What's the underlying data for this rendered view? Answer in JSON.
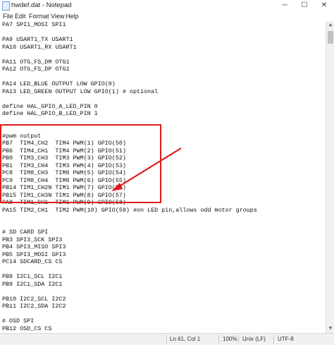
{
  "window": {
    "title": "hwdef.dat - Notepad",
    "minimize_icon": "─",
    "maximize_icon": "☐",
    "close_icon": "✕"
  },
  "menu": {
    "items": [
      "File",
      "Edit",
      "Format",
      "View",
      "Help"
    ]
  },
  "editor": {
    "lines": [
      "PA7 SPI1_MOSI SPI1",
      "",
      "PA9 USART1_TX USART1",
      "PA10 USART1_RX USART1",
      "",
      "PA11 OTG_FS_DM OTG1",
      "PA12 OTG_FS_DP OTG1",
      "",
      "PA14 LED_BLUE OUTPUT LOW GPIO(0)",
      "PA13 LED_GREEN OUTPUT LOW GPIO(1) # optional",
      "",
      "define HAL_GPIO_A_LED_PIN 0",
      "define HAL_GPIO_B_LED_PIN 1",
      "",
      "",
      "#pwm output",
      "PB7  TIM4_CH2  TIM4 PWM(1) GPIO(50)",
      "PB6  TIM4_CH1  TIM4 PWM(2) GPIO(51)",
      "PB0  TIM3_CH3  TIM3 PWM(3) GPIO(52)",
      "PB1  TIM3_CH4  TIM3 PWM(4) GPIO(53)",
      "PC8  TIM8_CH3  TIM8 PWM(5) GPIO(54)",
      "PC9  TIM8_CH4  TIM8 PWM(6) GPIO(55)",
      "PB14 TIM1_CH2N TIM1 PWM(7) GPIO(56)",
      "PB15 TIM1_CH3N TIM1 PWM(8) GPIO(57)",
      "PA8  TIM1_CH1  TIM1 PWM(9) GPIO(58)",
      "PA15 TIM2_CH1  TIM2 PWM(10) GPIO(59) #on LED pin,allows odd motor groups",
      "",
      "",
      "# SD CARD SPI",
      "PB3 SPI3_SCK SPI3",
      "PB4 SPI3_MISO SPI3",
      "PB5 SPI3_MOSI SPI3",
      "PC14 SDCARD_CS CS",
      "",
      "PB8 I2C1_SCL I2C1",
      "PB9 I2C1_SDA I2C1",
      "",
      "PB10 I2C2_SCL I2C2",
      "PB11 I2C2_SDA I2C2",
      "",
      "# OSD SPI",
      "PB12 OSD_CS CS",
      "PB13 SPI2_SCK SPI2",
      "PC2 SPI2_MISO SPI2"
    ]
  },
  "statusbar": {
    "position": "Ln 61, Col 1",
    "zoom": "100%",
    "line_ending": "Unix (LF)",
    "encoding": "UTF-8"
  },
  "annotation": {
    "color": "#e01b1b"
  }
}
